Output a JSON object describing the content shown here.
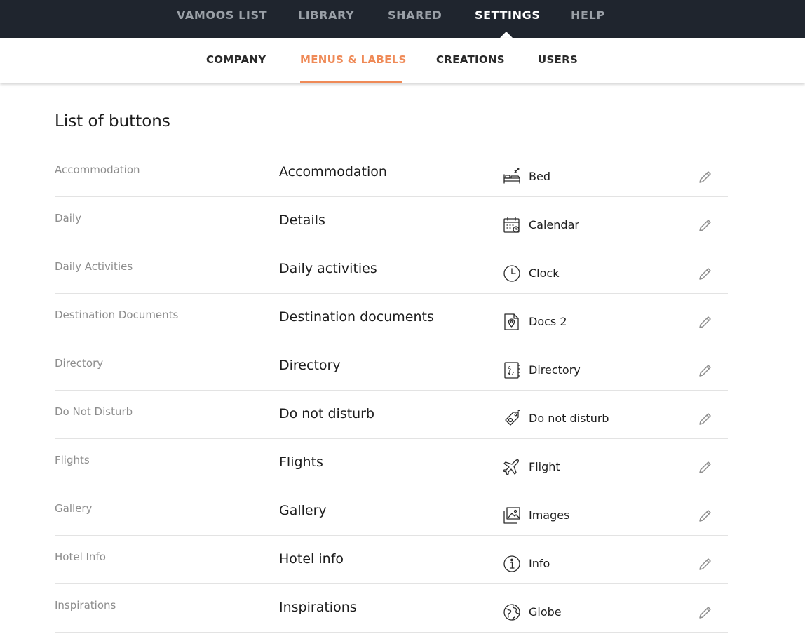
{
  "top_nav": {
    "items": [
      {
        "label": "VAMOOS LIST"
      },
      {
        "label": "LIBRARY"
      },
      {
        "label": "SHARED"
      },
      {
        "label": "SETTINGS",
        "active": true
      },
      {
        "label": "HELP"
      }
    ]
  },
  "sub_nav": {
    "items": [
      {
        "label": "COMPANY"
      },
      {
        "label": "MENUS & LABELS",
        "active": true
      },
      {
        "label": "CREATIONS"
      },
      {
        "label": "USERS"
      }
    ]
  },
  "colors": {
    "top_nav_bg": "#1f252e",
    "accent": "#ef8a57",
    "muted_text": "#8d8d8d"
  },
  "page": {
    "title": "List of buttons"
  },
  "buttons": [
    {
      "system_name": "Accommodation",
      "label": "Accommodation",
      "icon": "bed-icon",
      "icon_name": "Bed"
    },
    {
      "system_name": "Daily",
      "label": "Details",
      "icon": "calendar-icon",
      "icon_name": "Calendar"
    },
    {
      "system_name": "Daily Activities",
      "label": "Daily activities",
      "icon": "clock-icon",
      "icon_name": "Clock"
    },
    {
      "system_name": "Destination Documents",
      "label": "Destination documents",
      "icon": "docs-icon",
      "icon_name": "Docs 2"
    },
    {
      "system_name": "Directory",
      "label": "Directory",
      "icon": "directory-icon",
      "icon_name": "Directory"
    },
    {
      "system_name": "Do Not Disturb",
      "label": "Do not disturb",
      "icon": "do-not-disturb-tag-icon",
      "icon_name": "Do not disturb"
    },
    {
      "system_name": "Flights",
      "label": "Flights",
      "icon": "flight-icon",
      "icon_name": "Flight"
    },
    {
      "system_name": "Gallery",
      "label": "Gallery",
      "icon": "images-icon",
      "icon_name": "Images"
    },
    {
      "system_name": "Hotel Info",
      "label": "Hotel info",
      "icon": "info-icon",
      "icon_name": "Info"
    },
    {
      "system_name": "Inspirations",
      "label": "Inspirations",
      "icon": "globe-icon",
      "icon_name": "Globe"
    }
  ]
}
